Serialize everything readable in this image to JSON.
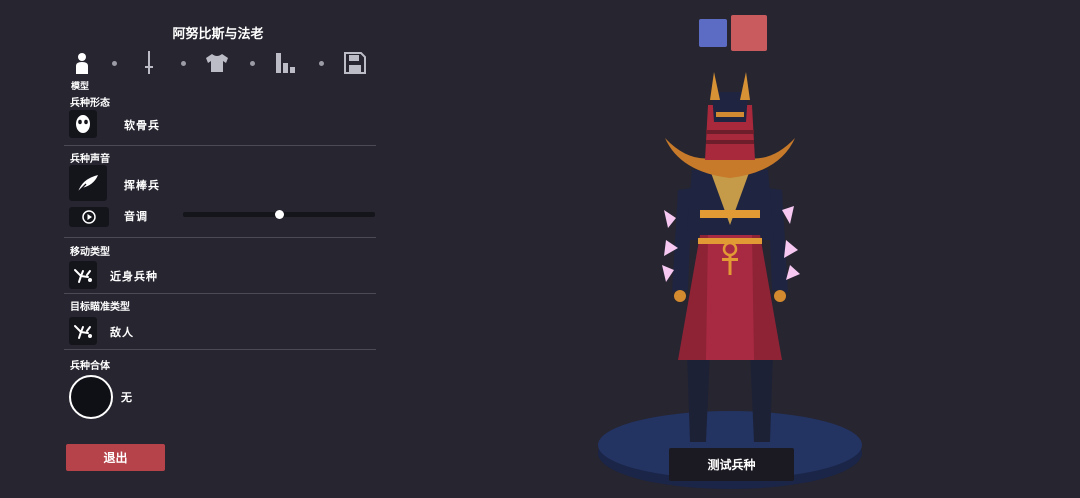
{
  "title": "阿努比斯与法老",
  "tabs": [
    {
      "name": "model",
      "icon": "person-icon",
      "caption": "模型"
    },
    {
      "name": "weapon",
      "icon": "sword-icon"
    },
    {
      "name": "clothing",
      "icon": "shirt-icon"
    },
    {
      "name": "stats",
      "icon": "bar-chart-icon"
    },
    {
      "name": "save",
      "icon": "save-icon"
    }
  ],
  "sections": {
    "form": {
      "label": "兵种形态",
      "icon": "mask-icon",
      "value": "软骨兵"
    },
    "voice": {
      "label": "兵种声音",
      "icon": "feather-icon",
      "value": "挥棒兵",
      "pitch_label": "音调",
      "pitch_value": 0.5
    },
    "movement": {
      "label": "移动类型",
      "icon": "unit-icon",
      "value": "近身兵种"
    },
    "targeting": {
      "label": "目标瞄准类型",
      "icon": "unit-icon",
      "value": "敌人"
    },
    "combo": {
      "label": "兵种合体",
      "value": "无"
    }
  },
  "buttons": {
    "exit": "退出",
    "test_unit": "测试兵种"
  },
  "team_colors": {
    "blue": "#5c6cc4",
    "red": "#c95a5e"
  },
  "colors": {
    "background": "#262530",
    "exit_button": "#b6424a"
  }
}
